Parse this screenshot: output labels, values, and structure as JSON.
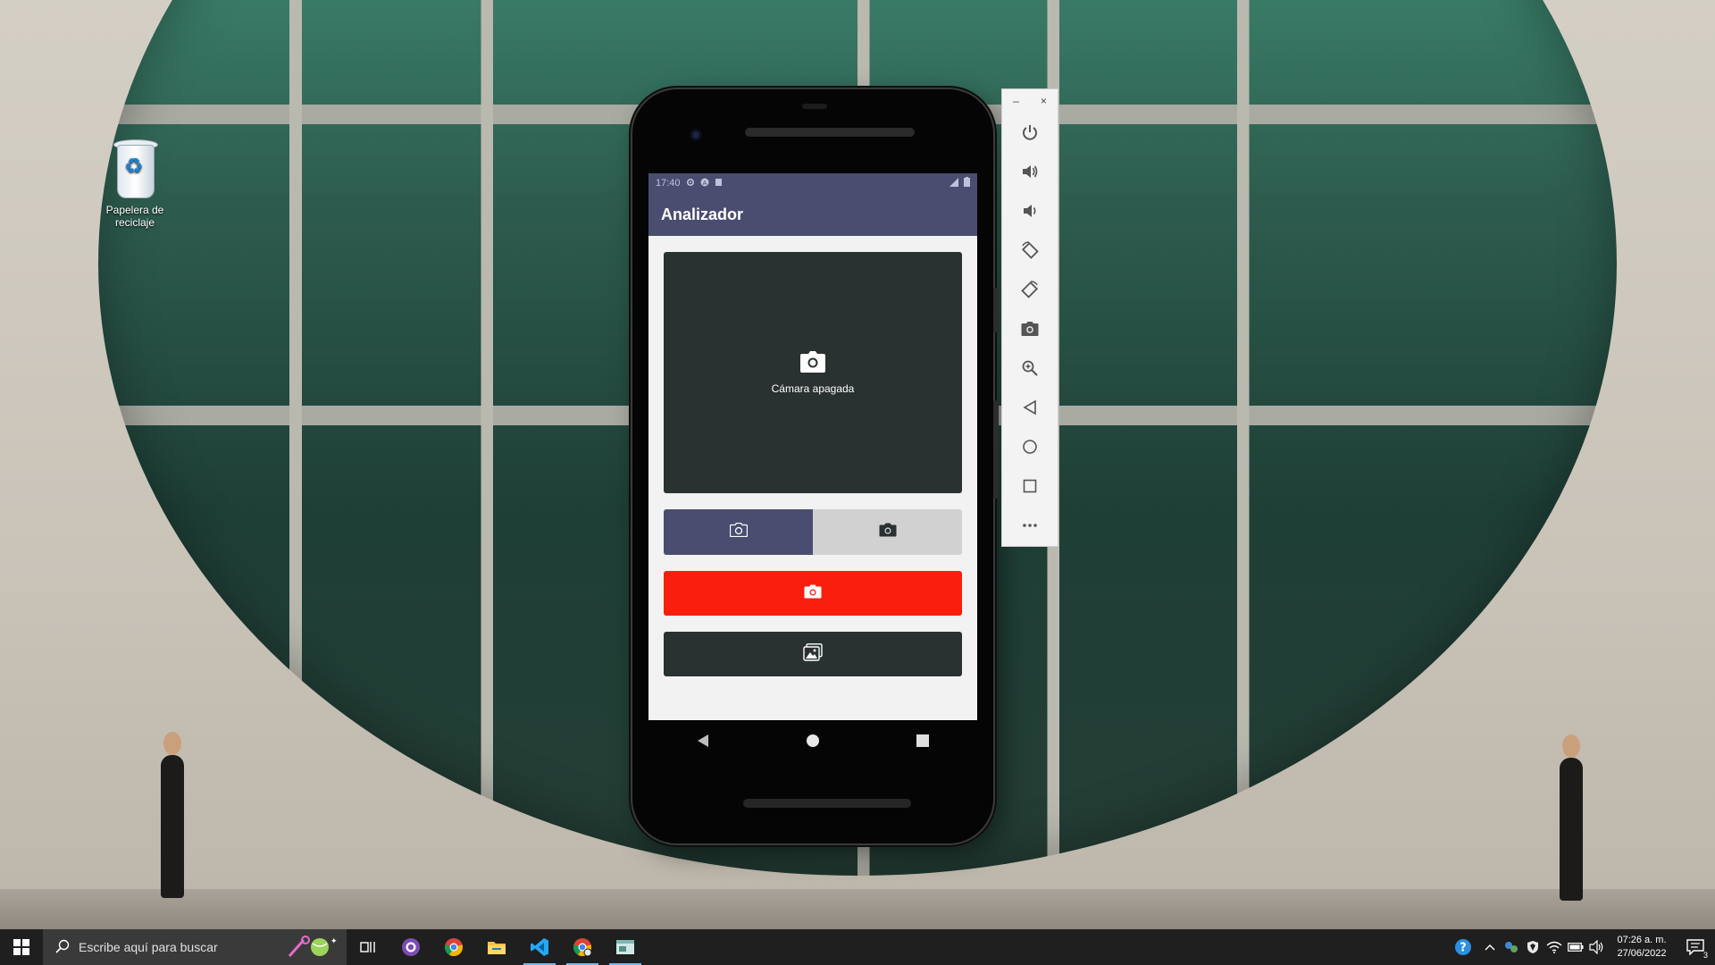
{
  "desktop": {
    "recycle_bin_label": "Papelera de reciclaje"
  },
  "phone": {
    "status_time": "17:40",
    "app_title": "Analizador",
    "preview_message": "Cámara apagada",
    "accent_color": "#4a4d70",
    "capture_color": "#fa1e0e"
  },
  "emulator_toolbar": {
    "minimize": "–",
    "close": "×",
    "tools": [
      "power-icon",
      "volume-up-icon",
      "volume-down-icon",
      "rotate-left-icon",
      "rotate-right-icon",
      "screenshot-icon",
      "zoom-icon",
      "back-icon",
      "home-icon",
      "overview-icon",
      "more-icon"
    ]
  },
  "taskbar": {
    "search_placeholder": "Escribe aquí para buscar",
    "time": "07:26 a. m.",
    "date": "27/06/2022",
    "notifications_count": "3"
  }
}
